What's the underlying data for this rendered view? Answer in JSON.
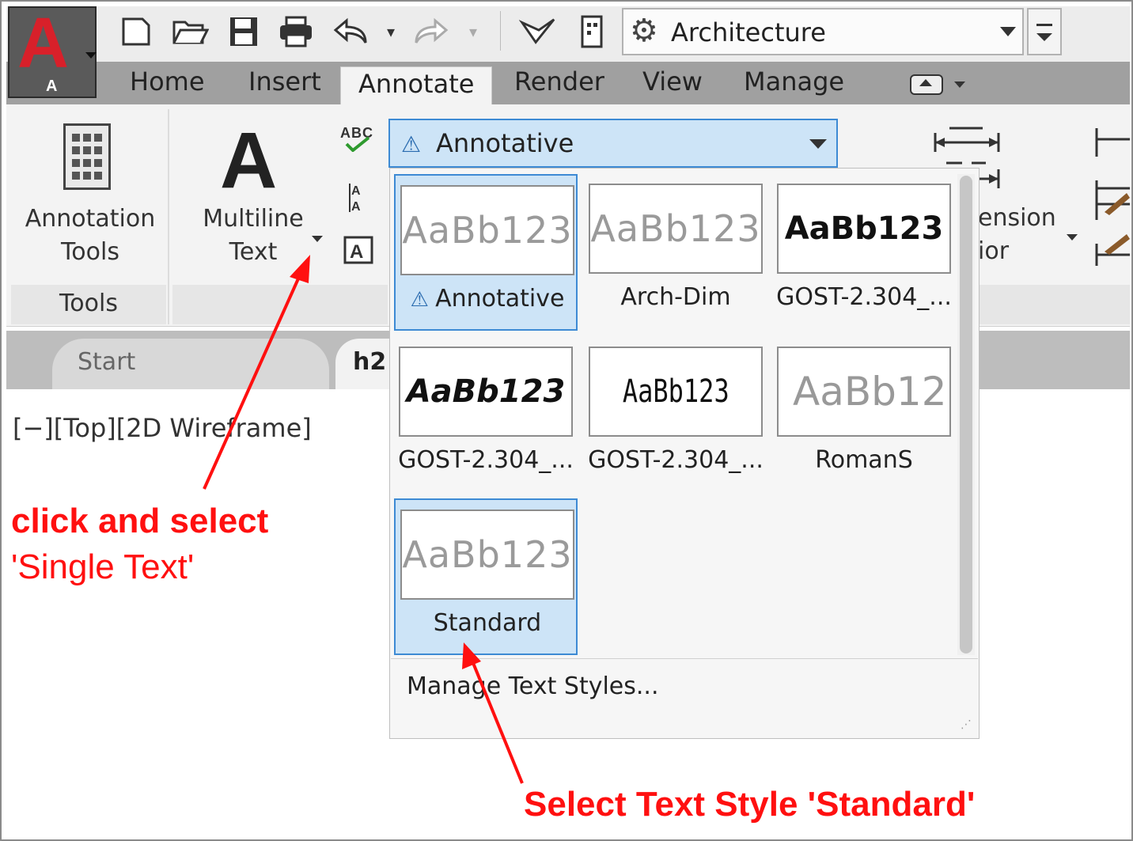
{
  "app": {
    "logo_letter": "A",
    "logo_sub": "A"
  },
  "quick_access": {
    "icons": [
      "new-icon",
      "open-icon",
      "save-icon",
      "print-icon",
      "undo-icon",
      "redo-icon",
      "share-icon",
      "sheetset-icon"
    ],
    "workspace": "Architecture"
  },
  "ribbon_tabs": [
    "Home",
    "Insert",
    "Annotate",
    "Render",
    "View",
    "Manage"
  ],
  "active_tab": "Annotate",
  "panels": {
    "annotation_tools_label_1": "Annotation",
    "annotation_tools_label_2": "Tools",
    "tools_title": "Tools",
    "multiline_label_1": "Multiline",
    "multiline_label_2": "Text",
    "spell_check_icon_text": "ABC",
    "dimension_label_1": "ension",
    "dimension_label_2": "ior"
  },
  "text_style_combo": {
    "value": "Annotative"
  },
  "gallery": {
    "styles": [
      {
        "name": "Annotative",
        "preview": "AaBb123",
        "selected": true
      },
      {
        "name": "Arch-Dim",
        "preview": "AaBb123",
        "selected": false
      },
      {
        "name": "GOST-2.304_...",
        "preview": "AaBb123",
        "selected": false
      },
      {
        "name": "GOST-2.304_...",
        "preview": "AaBb123",
        "selected": false
      },
      {
        "name": "GOST-2.304_...",
        "preview": "AaBb123",
        "selected": false
      },
      {
        "name": "RomanS",
        "preview": "AaBb12",
        "selected": false
      },
      {
        "name": "Standard",
        "preview": "AaBb123",
        "selected": true
      }
    ],
    "manage_link": "Manage Text Styles..."
  },
  "file_tabs": {
    "start": "Start",
    "drawing": "h2"
  },
  "viewport_label": "[−][Top][2D Wireframe]",
  "annotations": {
    "note1_line1": "click and select",
    "note1_line2": "'Single Text'",
    "note2": "Select Text Style 'Standard'"
  },
  "colors": {
    "accent": "#3d8ad4",
    "selected_bg": "#cde4f7",
    "annotation_red": "#ff1010",
    "logo_red": "#d8202a"
  }
}
